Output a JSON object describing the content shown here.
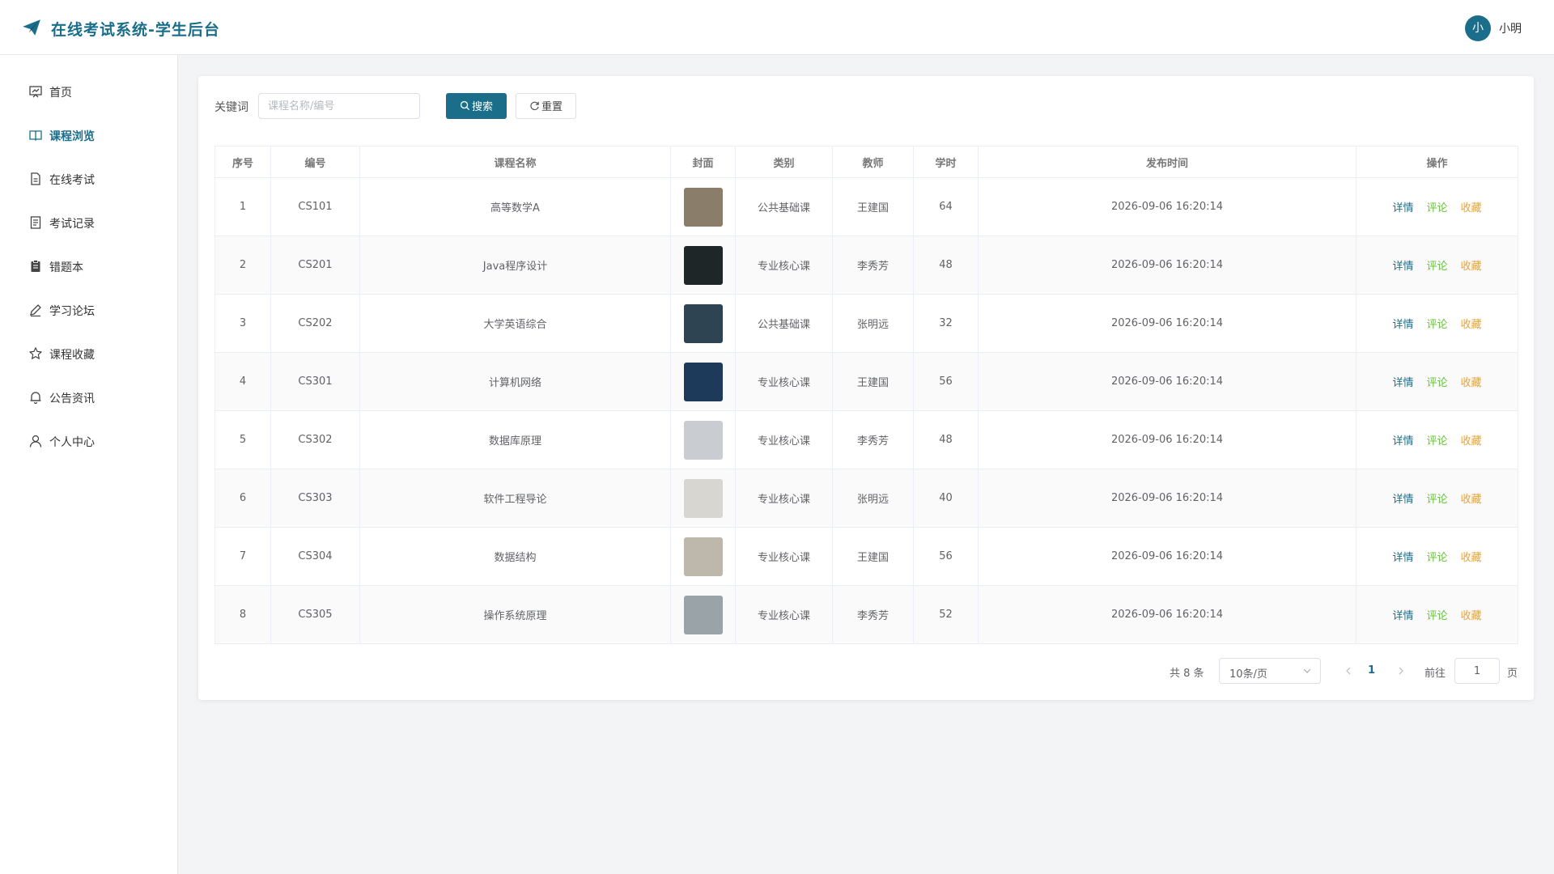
{
  "header": {
    "title": "在线考试系统-学生后台",
    "avatar_text": "小",
    "user_name": "小明"
  },
  "colors": {
    "primary": "#1a6e8a",
    "success": "#67c23a",
    "warning": "#e6a23c"
  },
  "sidebar": {
    "items": [
      {
        "label": "首页",
        "icon": "dashboard-icon"
      },
      {
        "label": "课程浏览",
        "icon": "book-open-icon",
        "active": true
      },
      {
        "label": "在线考试",
        "icon": "document-icon"
      },
      {
        "label": "考试记录",
        "icon": "list-doc-icon"
      },
      {
        "label": "错题本",
        "icon": "clipboard-icon"
      },
      {
        "label": "学习论坛",
        "icon": "pen-icon"
      },
      {
        "label": "课程收藏",
        "icon": "star-icon"
      },
      {
        "label": "公告资讯",
        "icon": "bell-icon"
      },
      {
        "label": "个人中心",
        "icon": "user-icon"
      }
    ]
  },
  "search": {
    "label": "关键词",
    "placeholder": "课程名称/编号",
    "value": "",
    "search_label": "搜索",
    "reset_label": "重置"
  },
  "table": {
    "headers": [
      "序号",
      "编号",
      "课程名称",
      "封面",
      "类别",
      "教师",
      "学时",
      "发布时间",
      "操作"
    ],
    "actions": {
      "detail": "详情",
      "comment": "评论",
      "favorite": "收藏"
    },
    "rows": [
      {
        "index": "1",
        "code": "CS101",
        "name": "高等数学A",
        "category": "公共基础课",
        "teacher": "王建国",
        "hours": "64",
        "published": "2026-09-06 16:20:14",
        "cover_color": "#8a7d6a"
      },
      {
        "index": "2",
        "code": "CS201",
        "name": "Java程序设计",
        "category": "专业核心课",
        "teacher": "李秀芳",
        "hours": "48",
        "published": "2026-09-06 16:20:14",
        "cover_color": "#1e2628"
      },
      {
        "index": "3",
        "code": "CS202",
        "name": "大学英语综合",
        "category": "公共基础课",
        "teacher": "张明远",
        "hours": "32",
        "published": "2026-09-06 16:20:14",
        "cover_color": "#2f4452"
      },
      {
        "index": "4",
        "code": "CS301",
        "name": "计算机网络",
        "category": "专业核心课",
        "teacher": "王建国",
        "hours": "56",
        "published": "2026-09-06 16:20:14",
        "cover_color": "#1d3a5a"
      },
      {
        "index": "5",
        "code": "CS302",
        "name": "数据库原理",
        "category": "专业核心课",
        "teacher": "李秀芳",
        "hours": "48",
        "published": "2026-09-06 16:20:14",
        "cover_color": "#c9cdd1"
      },
      {
        "index": "6",
        "code": "CS303",
        "name": "软件工程导论",
        "category": "专业核心课",
        "teacher": "张明远",
        "hours": "40",
        "published": "2026-09-06 16:20:14",
        "cover_color": "#d8d6d0"
      },
      {
        "index": "7",
        "code": "CS304",
        "name": "数据结构",
        "category": "专业核心课",
        "teacher": "王建国",
        "hours": "56",
        "published": "2026-09-06 16:20:14",
        "cover_color": "#bdb7ac"
      },
      {
        "index": "8",
        "code": "CS305",
        "name": "操作系统原理",
        "category": "专业核心课",
        "teacher": "李秀芳",
        "hours": "52",
        "published": "2026-09-06 16:20:14",
        "cover_color": "#9aa3a8"
      }
    ]
  },
  "pagination": {
    "total_text": "共 8 条",
    "page_size": "10条/页",
    "current_page": "1",
    "goto_label": "前往",
    "goto_value": "1",
    "page_suffix": "页"
  }
}
